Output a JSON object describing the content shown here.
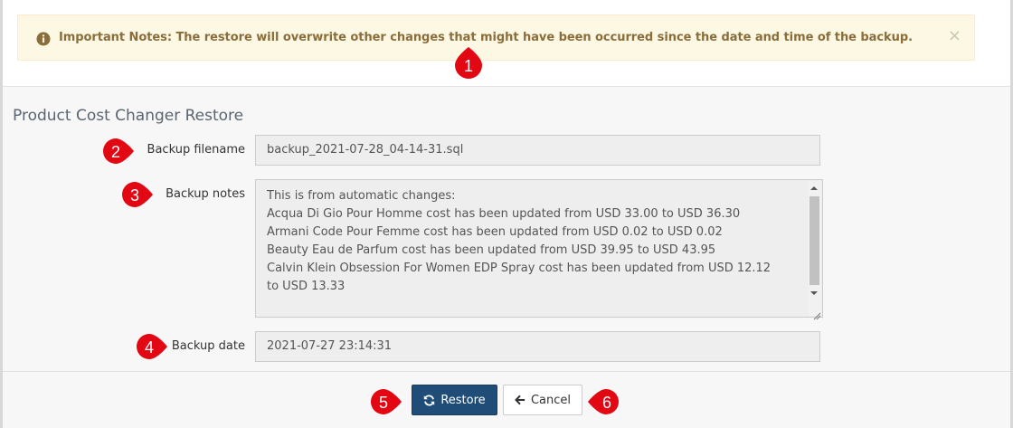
{
  "alert": {
    "text": "Important Notes: The restore will overwrite other changes that might have been occurred since the date and time of the backup.",
    "close": "×"
  },
  "panel": {
    "title": "Product Cost Changer Restore"
  },
  "form": {
    "filename_label": "Backup filename",
    "filename_value": "backup_2021-07-28_04-14-31.sql",
    "notes_label": "Backup notes",
    "notes_lines": [
      "This is from automatic changes:",
      "Acqua Di Gio Pour Homme cost has been updated from USD 33.00 to USD 36.30",
      "Armani Code Pour Femme cost has been updated from USD 0.02 to USD 0.02",
      "Beauty Eau de Parfum cost has been updated from USD 39.95 to USD 43.95",
      "Calvin Klein Obsession For Women EDP Spray cost has been updated from USD 12.12",
      "to USD 13.33"
    ],
    "date_label": "Backup date",
    "date_value": "2021-07-27 23:14:31"
  },
  "actions": {
    "restore_label": "Restore",
    "cancel_label": "Cancel"
  },
  "markers": [
    "1",
    "2",
    "3",
    "4",
    "5",
    "6"
  ],
  "icons": {
    "info": "info-circle-icon",
    "restore": "refresh-icon",
    "cancel": "arrow-left-icon"
  },
  "colors": {
    "alert_bg": "#fcf8e3",
    "alert_text": "#8a6d3b",
    "primary": "#1f4d78",
    "marker": "#e30613"
  }
}
